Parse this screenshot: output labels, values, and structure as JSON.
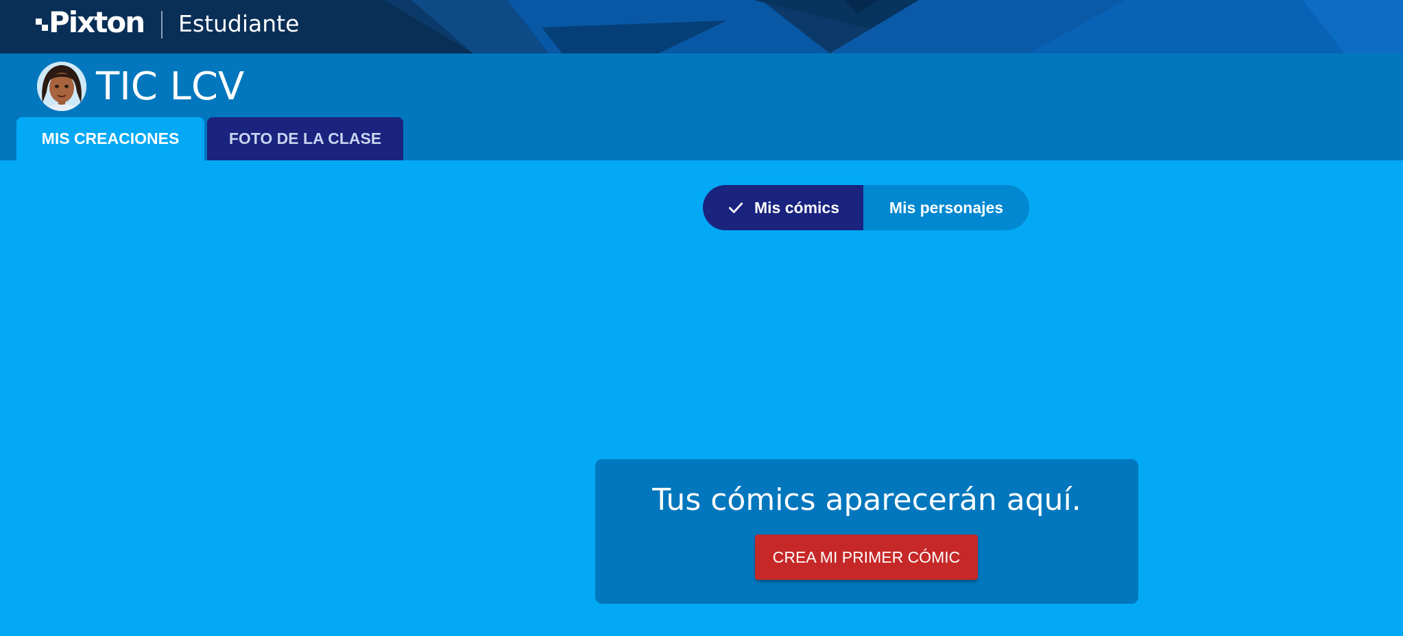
{
  "header": {
    "logo_text": "Pixton",
    "role": "Estudiante"
  },
  "class_header": {
    "class_name": "TIC LCV",
    "avatar_icon": "student-avatar-icon"
  },
  "tabs": [
    {
      "label": "MIS CREACIONES",
      "active": true
    },
    {
      "label": "FOTO DE LA CLASE",
      "active": false
    }
  ],
  "view_toggle": {
    "options": [
      {
        "label": "Mis cómics",
        "selected": true,
        "icon": "check-icon"
      },
      {
        "label": "Mis personajes",
        "selected": false
      }
    ]
  },
  "empty_state": {
    "message": "Tus cómics aparecerán aquí.",
    "button_label": "CREA MI PRIMER CÓMIC"
  },
  "colors": {
    "header_dark": "#0a3a6b",
    "class_band": "#0277bd",
    "page_bg": "#03a9f4",
    "tab_inactive": "#1a237e",
    "toggle_selected": "#1a237e",
    "toggle_unselected": "#0288d1",
    "cta_red": "#c62828"
  }
}
